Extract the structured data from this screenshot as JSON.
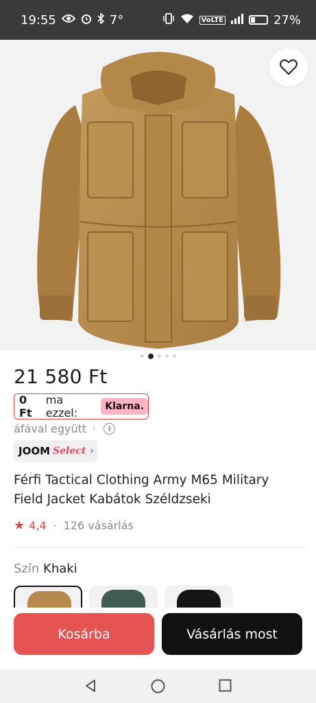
{
  "status_bar": {
    "time": "19:55",
    "temperature": "7°",
    "network_badge": "VoLTE",
    "battery_percent": "27%",
    "battery_level": 0.27,
    "icons": [
      "eye-icon",
      "alarm-icon",
      "bluetooth-icon",
      "vibrate-icon",
      "wifi-icon",
      "signal-icon",
      "battery-icon"
    ]
  },
  "gallery": {
    "image_count": 5,
    "active_index": 1,
    "favorite_icon": "heart-outline-icon"
  },
  "product": {
    "price": "21 580 Ft",
    "klarna": {
      "amount": "0 Ft",
      "text": "ma ezzel:",
      "badge": "Klarna."
    },
    "vat_note": "áfával együtt",
    "vat_separator": "·",
    "joom_badge": {
      "brand": "JOOM",
      "select": "Select",
      "chevron": "›"
    },
    "title": "Férfi Tactical Clothing Army M65 Military Field Jacket Kabátok Széldzseki",
    "rating": "4,4",
    "rating_separator": "·",
    "purchases": "126 vásárlás"
  },
  "color_selector": {
    "label": "Szín",
    "selected": "Khaki",
    "swatches": [
      {
        "name": "khaki",
        "color": "#b58a4c",
        "selected": true
      },
      {
        "name": "green",
        "color": "#3f5b52",
        "selected": false
      },
      {
        "name": "black",
        "color": "#151515",
        "selected": false
      }
    ]
  },
  "actions": {
    "add_to_cart": "Kosárba",
    "buy_now": "Vásárlás most"
  },
  "colors": {
    "accent_red": "#e55353",
    "primary_black": "#111111",
    "khaki": "#b58a4c",
    "klarna_pink": "#ffb3c7"
  }
}
